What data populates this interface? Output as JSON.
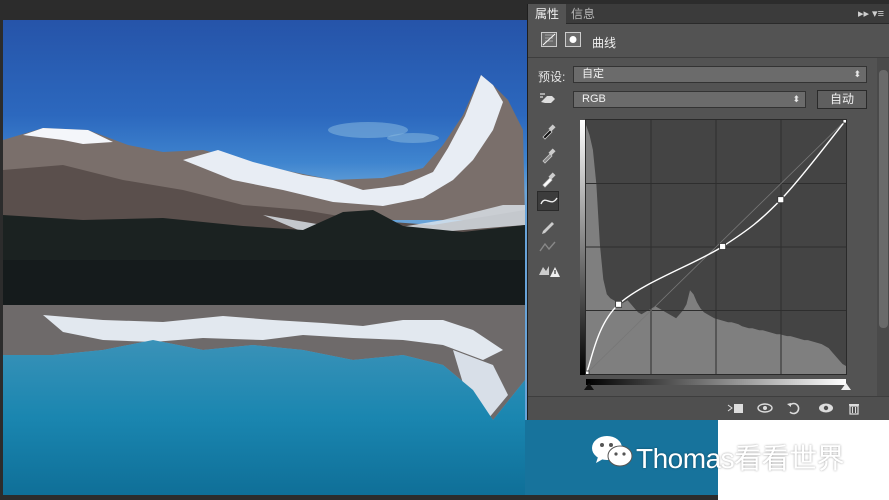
{
  "panel": {
    "tabs": [
      {
        "label": "属性",
        "active": true
      },
      {
        "label": "信息",
        "active": false
      }
    ],
    "menu_icon": "panel-menu-icon",
    "adjustment_title": "曲线",
    "preset_label": "预设:",
    "preset_value": "自定",
    "channel_value": "RGB",
    "auto_button": "自动"
  },
  "curve": {
    "points": [
      [
        0,
        0
      ],
      [
        32,
        70
      ],
      [
        134,
        128
      ],
      [
        191,
        175
      ],
      [
        255,
        255
      ]
    ],
    "histogram_color": "#8a8a8a",
    "curve_color": "#ffffff"
  },
  "tools": [
    "on-image-adjust-icon",
    "black-point-eyedropper-icon",
    "gray-point-eyedropper-icon",
    "white-point-eyedropper-icon",
    "curve-edit-icon",
    "pencil-draw-icon",
    "smooth-curve-icon",
    "clipping-warning-icon"
  ],
  "bottom_icons": [
    "clip-to-layer-icon",
    "view-previous-icon",
    "reset-icon",
    "visibility-icon",
    "delete-icon"
  ],
  "watermark": {
    "text": "Thomas看看世界"
  }
}
